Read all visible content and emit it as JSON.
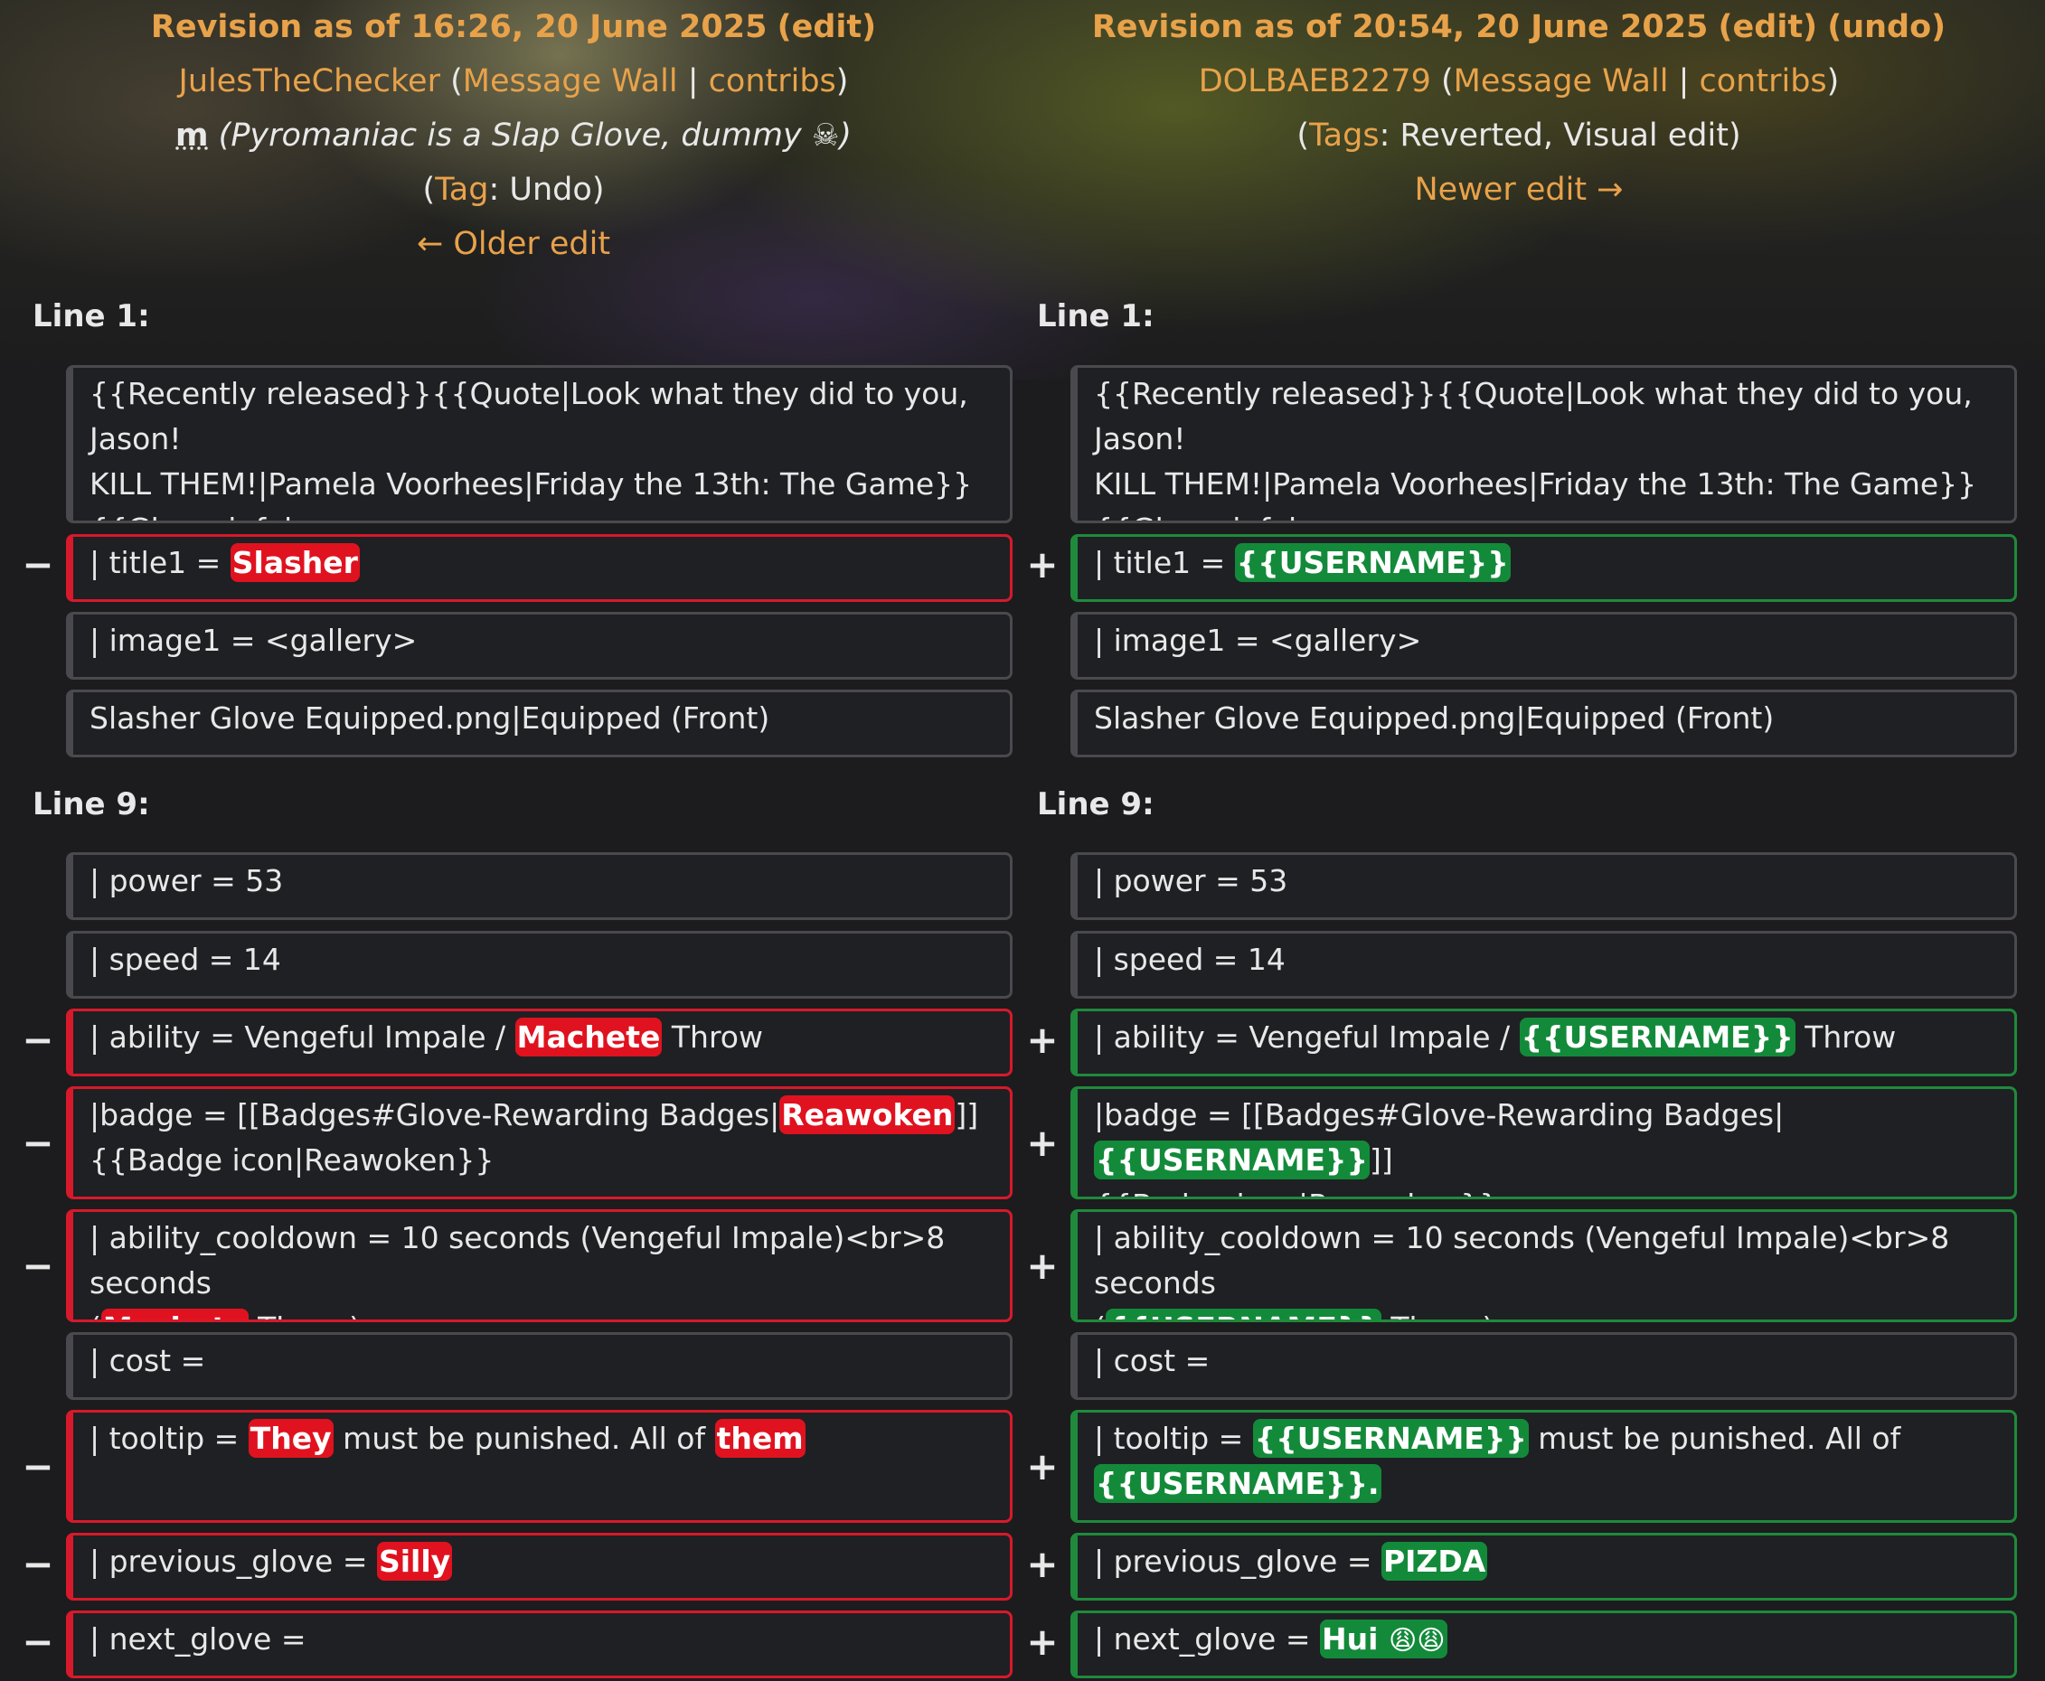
{
  "header": {
    "left": {
      "title": "Revision as of 16:26, 20 June 2025",
      "edit_link": "edit",
      "user": "JulesTheChecker",
      "message_wall": "Message Wall",
      "contribs": "contribs",
      "minor_flag": "m",
      "summary": "Pyromaniac is a Slap Glove, dummy",
      "summary_icon": "skull-icon",
      "tags_label": "Tag",
      "tags_value": "Undo",
      "nav_link": "← Older edit"
    },
    "right": {
      "title": "Revision as of 20:54, 20 June 2025",
      "edit_link": "edit",
      "undo_link": "undo",
      "user": "DOLBAEB2279",
      "message_wall": "Message Wall",
      "contribs": "contribs",
      "tags_label": "Tags",
      "tags_value": "Reverted, Visual edit",
      "nav_link": "Newer edit →"
    }
  },
  "diff": {
    "line1_label": "Line 1:",
    "line9_label": "Line 9:",
    "colors": {
      "removed": "#d8192b",
      "added": "#1f8a3c",
      "link": "#e8a24a"
    },
    "context_intro_1": "{{Recently released}}{{Quote|Look what they did to you, Jason!",
    "context_intro_2": "KILL THEM!|Pamela Voorhees|Friday the 13th: The Game}}",
    "context_intro_3": "{{Glove_infobox",
    "title_prefix": "| title1 = ",
    "title_old": "Slasher",
    "title_new": "{{USERNAME}}",
    "context_image": "| image1 = <gallery>",
    "context_gallery": "Slasher Glove Equipped.png|Equipped (Front)",
    "context_power": "| power = 53",
    "context_speed": "| speed = 14",
    "ability_prefix": "| ability = Vengeful Impale / ",
    "ability_old": "Machete",
    "ability_new": "{{USERNAME}}",
    "ability_suffix": " Throw",
    "badge_prefix": "|badge = [[Badges#Glove-Rewarding Badges|",
    "badge_old": "Reawoken",
    "badge_new": "{{USERNAME}}",
    "badge_suffix": "]]",
    "badge_line2": "{{Badge icon|Reawoken}}",
    "cooldown_line1": "| ability_cooldown = 10 seconds (Vengeful Impale)<br>8 seconds",
    "cooldown_open": "(",
    "cooldown_old": "Machete",
    "cooldown_new": "{{USERNAME}}",
    "cooldown_suffix": " Throw)",
    "context_cost": "| cost =",
    "tooltip_prefix": "| tooltip = ",
    "tooltip_old_1": "They",
    "tooltip_new_1": "{{USERNAME}}",
    "tooltip_mid": " must be punished. All of ",
    "tooltip_old_2": "them",
    "tooltip_new_2": "{{USERNAME}}.",
    "prev_prefix": "| previous_glove = ",
    "prev_old": "Silly",
    "prev_new": "PIZDA",
    "next_prefix": "| next_glove =",
    "next_new": "Hui",
    "next_new_emoji": "😩😩",
    "minus": "−",
    "plus": "+"
  }
}
